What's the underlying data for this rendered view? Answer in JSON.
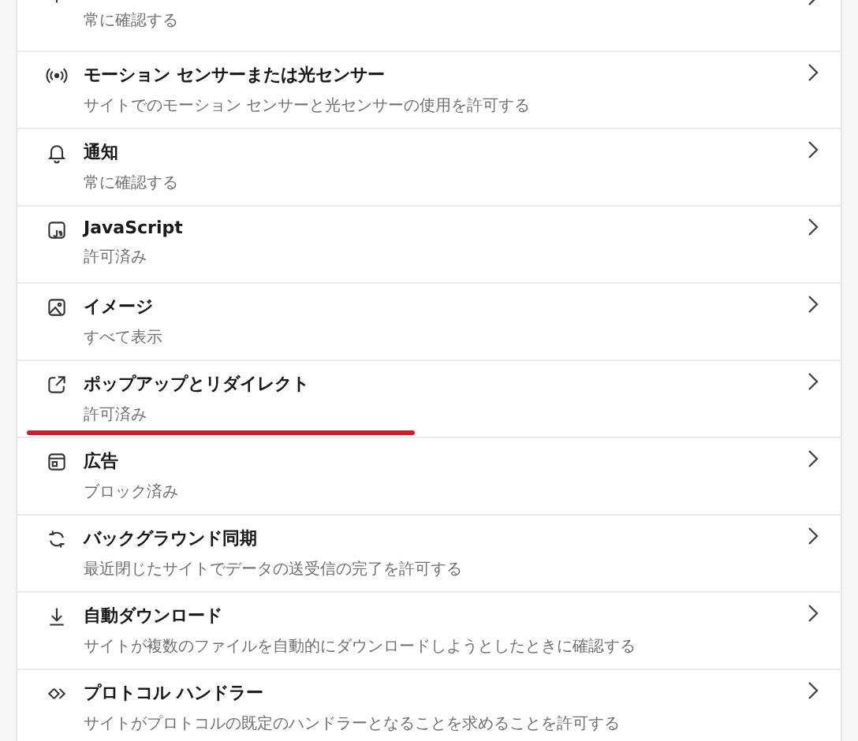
{
  "rows": [
    {
      "subtitle": "常に確認する",
      "underlined": false
    },
    {
      "title": "モーション センサーまたは光センサー",
      "subtitle": "サイトでのモーション センサーと光センサーの使用を許可する",
      "underlined": false
    },
    {
      "title": "通知",
      "subtitle": "常に確認する",
      "underlined": false
    },
    {
      "title": "JavaScript",
      "subtitle": "許可済み",
      "underlined": false
    },
    {
      "title": "イメージ",
      "subtitle": "すべて表示",
      "underlined": false
    },
    {
      "title": "ポップアップとリダイレクト",
      "subtitle": "許可済み",
      "underlined": true
    },
    {
      "title": "広告",
      "subtitle": "ブロック済み",
      "underlined": false
    },
    {
      "title": "バックグラウンド同期",
      "subtitle": "最近閉じたサイトでデータの送受信の完了を許可する",
      "underlined": false
    },
    {
      "title": "自動ダウンロード",
      "subtitle": "サイトが複数のファイルを自動的にダウンロードしようとしたときに確認する",
      "underlined": false
    },
    {
      "title": "プロトコル ハンドラー",
      "subtitle": "サイトがプロトコルの既定のハンドラーとなることを求めることを許可する",
      "underlined": false
    }
  ]
}
